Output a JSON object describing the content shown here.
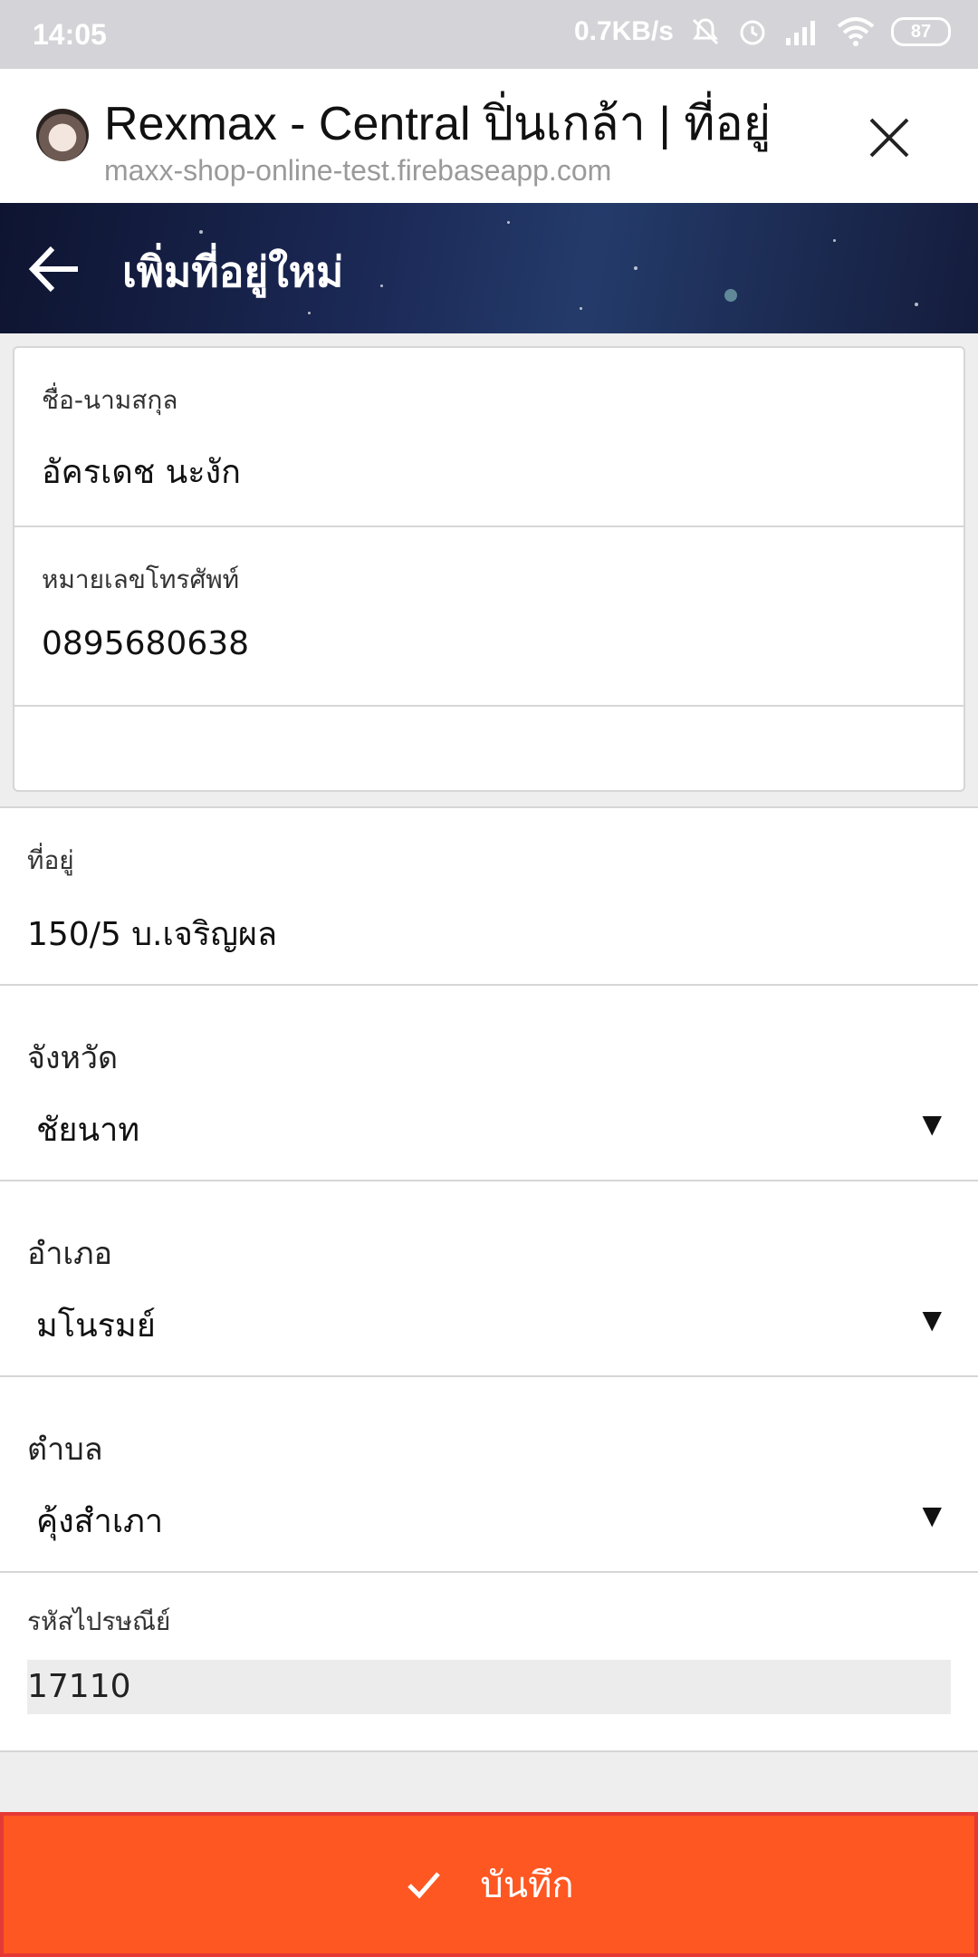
{
  "status_bar": {
    "time": "14:05",
    "speed": "0.7KB/s",
    "battery": "87"
  },
  "browser": {
    "title": "Rexmax - Central ปิ่นเกล้า | ที่อยู่",
    "url": "maxx-shop-online-test.firebaseapp.com"
  },
  "header": {
    "title": "เพิ่มที่อยู่ใหม่"
  },
  "form": {
    "name_label": "ชื่อ-นามสกุล",
    "name_value": "อัครเดช นะงัก",
    "phone_label": "หมายเลขโทรศัพท์",
    "phone_value": "0895680638",
    "address_label": "ที่อยู่",
    "address_value": "150/5 บ.เจริญผล",
    "province_label": "จังหวัด",
    "province_value": "ชัยนาท",
    "district_label": "อำเภอ",
    "district_value": "มโนรมย์",
    "subdistrict_label": "ตำบล",
    "subdistrict_value": "คุ้งสำเภา",
    "zip_label": "รหัสไปรษณีย์",
    "zip_value": "17110"
  },
  "actions": {
    "save_label": "บันทึก"
  },
  "colors": {
    "accent": "#ff5722",
    "highlight_border": "#e53935"
  },
  "icons": [
    "back-arrow-icon",
    "close-icon",
    "checkmark-icon",
    "caret-down-icon",
    "wifi-icon",
    "signal-icon",
    "alarm-icon",
    "mute-icon"
  ]
}
